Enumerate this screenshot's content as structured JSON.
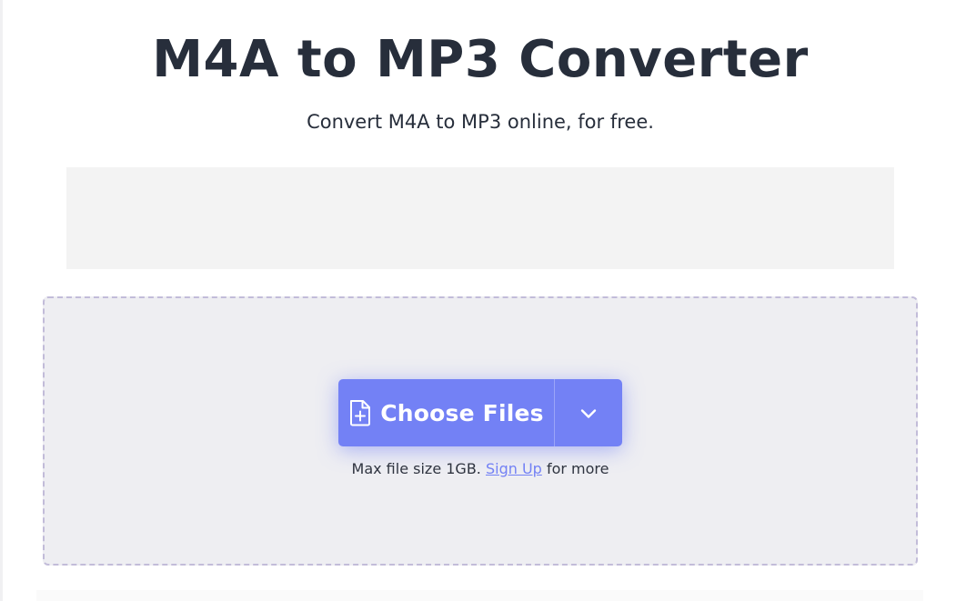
{
  "page": {
    "title": "M4A to MP3 Converter",
    "subtitle": "Convert M4A to MP3 online, for free."
  },
  "upload": {
    "choose_files_label": "Choose Files",
    "icons": {
      "file": "file-plus-icon",
      "more": "chevron-down-icon"
    },
    "limit_text_prefix": "Max file size 1GB.",
    "signup_link": "Sign Up",
    "limit_text_suffix": "for more"
  },
  "colors": {
    "accent": "#7381f5",
    "title_text": "#272e3b",
    "dropzone_bg": "#eeeef2",
    "dropzone_border": "#c2bcd9",
    "ad_bg": "#f3f3f3"
  }
}
